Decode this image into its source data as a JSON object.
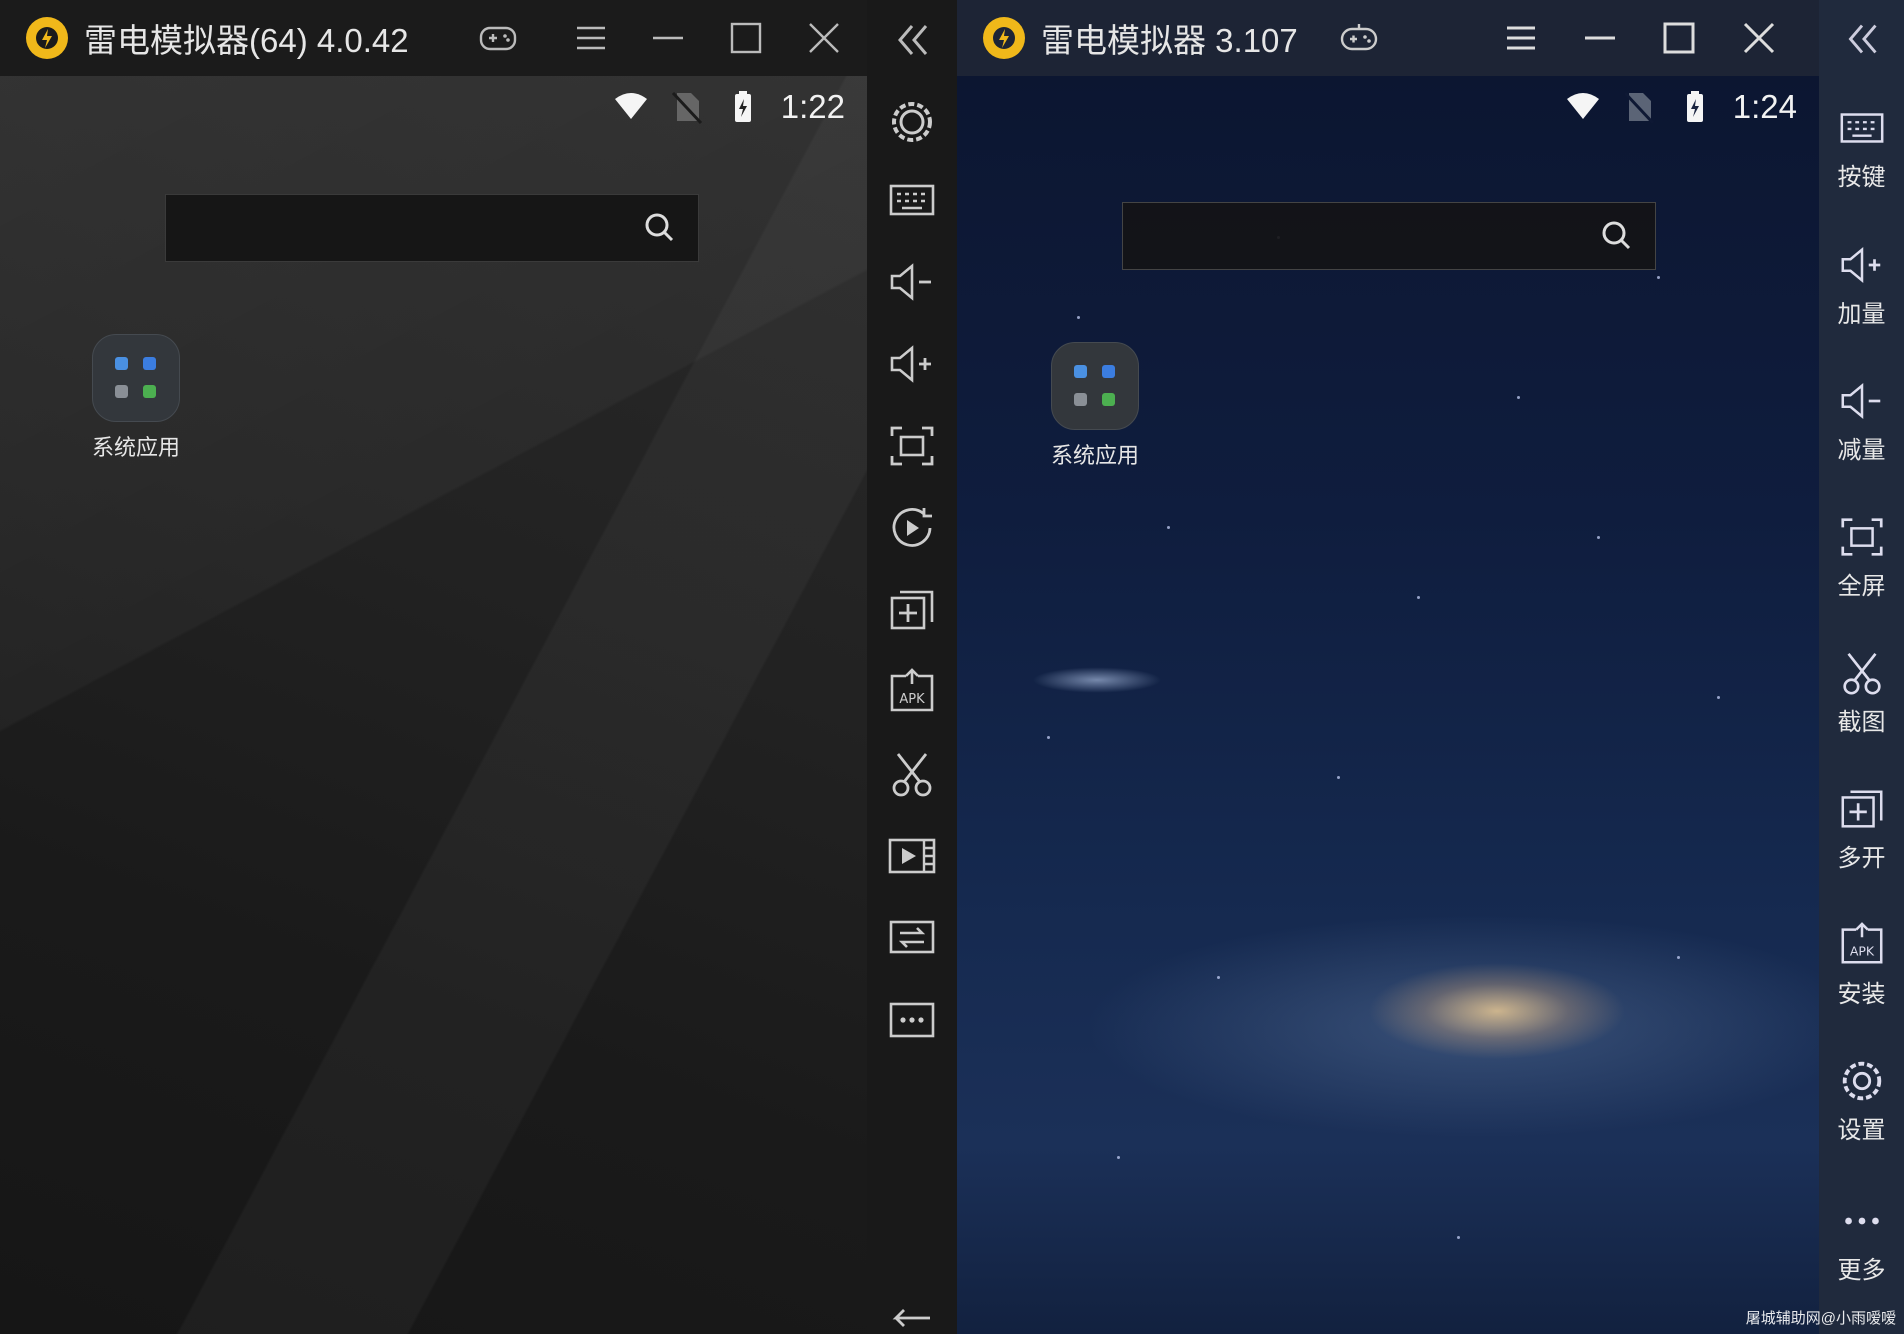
{
  "left_window": {
    "title": "雷电模拟器(64) 4.0.42",
    "status_time": "1:22",
    "search": {
      "placeholder": ""
    },
    "app": {
      "label": "系统应用"
    },
    "toolbar": [
      "settings-icon",
      "keyboard-icon",
      "volume-down-icon",
      "volume-up-icon",
      "fullscreen-icon",
      "record-icon",
      "multi-instance-icon",
      "apk-install-icon",
      "screenshot-icon",
      "video-icon",
      "sync-icon",
      "more-icon",
      "back-icon"
    ]
  },
  "right_window": {
    "title": "雷电模拟器 3.107",
    "status_time": "1:24",
    "search": {
      "placeholder": ""
    },
    "app": {
      "label": "系统应用"
    },
    "sidebar": {
      "keymap_label": "按键",
      "vol_up_label": "加量",
      "vol_down_label": "减量",
      "fullscreen_label": "全屏",
      "screenshot_label": "截图",
      "multi_label": "多开",
      "install_label": "安装",
      "settings_label": "设置",
      "more_label": "更多"
    }
  },
  "watermark": "屠城辅助网@小雨嗳嗳",
  "colors": {
    "logo": "#f0b81a",
    "left_bg": "#151515",
    "right_bg": "#0c1428"
  }
}
